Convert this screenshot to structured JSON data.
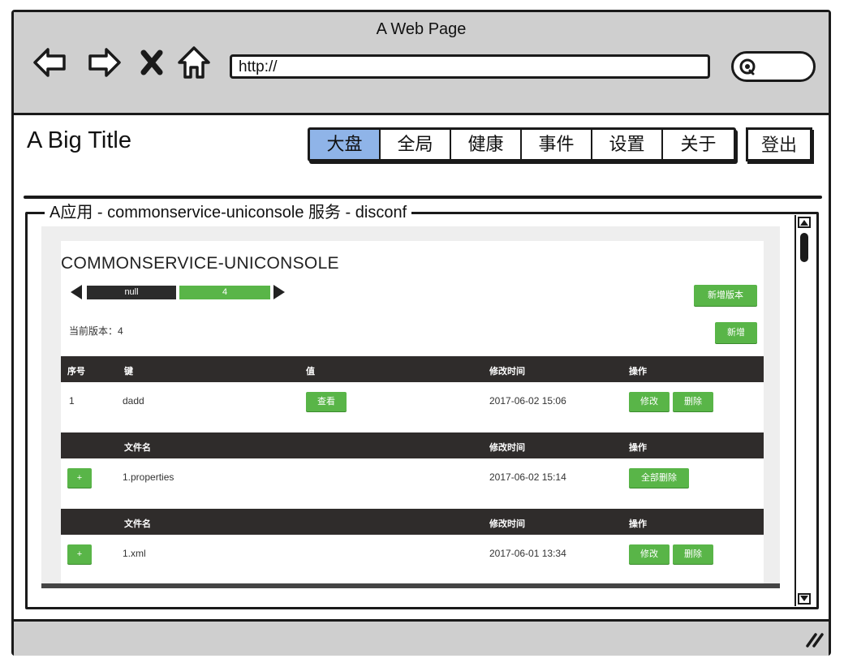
{
  "browser": {
    "window_title": "A Web Page",
    "url": "http://"
  },
  "header": {
    "title": "A Big Title",
    "tabs": [
      {
        "label": "大盘",
        "active": true
      },
      {
        "label": "全局",
        "active": false
      },
      {
        "label": "健康",
        "active": false
      },
      {
        "label": "事件",
        "active": false
      },
      {
        "label": "设置",
        "active": false
      },
      {
        "label": "关于",
        "active": false
      }
    ],
    "logout_label": "登出"
  },
  "panel": {
    "legend": "A应用 - commonservice-uniconsole 服务 - disconf"
  },
  "service": {
    "title": "COMMONSERVICE-UNICONSOLE",
    "versions": [
      "null",
      "4"
    ],
    "new_version_label": "新增版本",
    "add_label": "新增",
    "current_version_text": "当前版本：4"
  },
  "config_table": {
    "headers": {
      "index": "序号",
      "key": "键",
      "value": "值",
      "modified": "修改时间",
      "actions": "操作"
    },
    "rows": [
      {
        "index": "1",
        "key": "dadd",
        "view_label": "查看",
        "modified": "2017-06-02 15:06",
        "edit_label": "修改",
        "delete_label": "删除"
      }
    ]
  },
  "file_tables": [
    {
      "headers": {
        "name": "文件名",
        "modified": "修改时间",
        "actions": "操作"
      },
      "row": {
        "toggle": "+",
        "name": "1.properties",
        "modified": "2017-06-02 15:14",
        "delete_all_label": "全部删除"
      }
    },
    {
      "headers": {
        "name": "文件名",
        "modified": "修改时间",
        "actions": "操作"
      },
      "row": {
        "toggle": "+",
        "name": "1.xml",
        "modified": "2017-06-01 13:34",
        "edit_label": "修改",
        "delete_label": "删除"
      }
    }
  ],
  "colors": {
    "chrome_gray": "#cfcfcf",
    "active_tab": "#8fb4e8",
    "green": "#59b548",
    "table_header": "#2f2c2b"
  },
  "icons": [
    "back-arrow-icon",
    "forward-arrow-icon",
    "close-x-icon",
    "home-icon",
    "search-icon",
    "resize-grip-icon"
  ]
}
